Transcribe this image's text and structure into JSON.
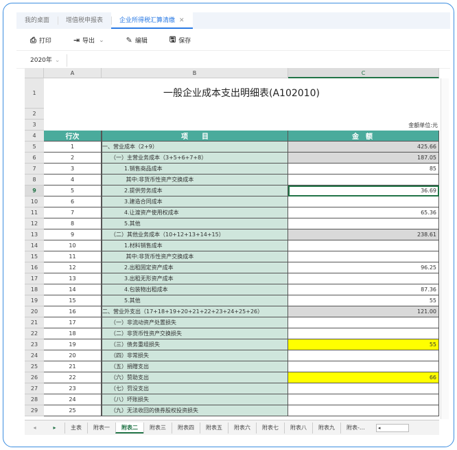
{
  "tabs": [
    {
      "label": "我的桌面"
    },
    {
      "label": "增值税申报表"
    },
    {
      "label": "企业所得税汇算清缴",
      "active": true
    }
  ],
  "toolbar": {
    "print": "打印",
    "export": "导出",
    "edit": "编辑",
    "save": "保存"
  },
  "year": "2020年",
  "columns": [
    "A",
    "B",
    "C"
  ],
  "sheet": {
    "title": "一般企业成本支出明细表(A102010)",
    "unit": "金额单位:元",
    "headers": [
      "行次",
      "项　　目",
      "金　额"
    ],
    "rows": [
      {
        "r": "5",
        "n": "1",
        "item": "一、营业成本（2+9）",
        "amt": "425.66",
        "style": "gray"
      },
      {
        "r": "6",
        "n": "2",
        "item": "　　（一）主营业务成本（3+5+6+7+8）",
        "amt": "187.05",
        "style": "gray"
      },
      {
        "r": "7",
        "n": "3",
        "item": "　　　　1.销售商品成本",
        "amt": "85"
      },
      {
        "r": "8",
        "n": "4",
        "item": "　　　　 其中:非货币性资产交换成本",
        "amt": ""
      },
      {
        "r": "9",
        "n": "5",
        "item": "　　　　2.提供劳务成本",
        "amt": "36.69",
        "style": "sel"
      },
      {
        "r": "10",
        "n": "6",
        "item": "　　　　3.建造合同成本",
        "amt": ""
      },
      {
        "r": "11",
        "n": "7",
        "item": "　　　　4.让渡资产使用权成本",
        "amt": "65.36"
      },
      {
        "r": "12",
        "n": "8",
        "item": "　　　　5.其他",
        "amt": ""
      },
      {
        "r": "13",
        "n": "9",
        "item": "　　（二）其他业务成本（10+12+13+14+15）",
        "amt": "238.61",
        "style": "gray"
      },
      {
        "r": "14",
        "n": "10",
        "item": "　　　　1.材料销售成本",
        "amt": ""
      },
      {
        "r": "15",
        "n": "11",
        "item": "　　　　 其中:非货币性资产交换成本",
        "amt": ""
      },
      {
        "r": "16",
        "n": "12",
        "item": "　　　　2.出租固定资产成本",
        "amt": "96.25"
      },
      {
        "r": "17",
        "n": "13",
        "item": "　　　　3.出租无形资产成本",
        "amt": ""
      },
      {
        "r": "18",
        "n": "14",
        "item": "　　　　4.包装物出租成本",
        "amt": "87.36"
      },
      {
        "r": "19",
        "n": "15",
        "item": "　　　　5.其他",
        "amt": "55"
      },
      {
        "r": "20",
        "n": "16",
        "item": "二、营业外支出（17+18+19+20+21+22+23+24+25+26）",
        "amt": "121.00",
        "style": "gray"
      },
      {
        "r": "21",
        "n": "17",
        "item": "　　（一）非流动资产处置损失",
        "amt": ""
      },
      {
        "r": "22",
        "n": "18",
        "item": "　　（二）非货币性资产交换损失",
        "amt": ""
      },
      {
        "r": "23",
        "n": "19",
        "item": "　　（三）债务重组损失",
        "amt": "55",
        "style": "yellow"
      },
      {
        "r": "24",
        "n": "20",
        "item": "　　（四）非常损失",
        "amt": ""
      },
      {
        "r": "25",
        "n": "21",
        "item": "　　（五）捐赠支出",
        "amt": ""
      },
      {
        "r": "26",
        "n": "22",
        "item": "　　（六）赞助支出",
        "amt": "66",
        "style": "yellow"
      },
      {
        "r": "27",
        "n": "23",
        "item": "　　（七）罚没支出",
        "amt": ""
      },
      {
        "r": "28",
        "n": "24",
        "item": "　　（八）坏账损失",
        "amt": ""
      },
      {
        "r": "29",
        "n": "25",
        "item": "　　（九）无法收回的债券股权投资损失",
        "amt": ""
      }
    ]
  },
  "sheet_tabs": [
    "主表",
    "附表一",
    "附表二",
    "附表三",
    "附表四",
    "附表五",
    "附表六",
    "附表七",
    "附表八",
    "附表九",
    "附表-…"
  ],
  "active_sheet": "附表二",
  "colors": {
    "header": "#4aab9c",
    "item_bg": "#cfe6dc",
    "highlight": "#ffff00",
    "accent": "#2a7ae4"
  }
}
